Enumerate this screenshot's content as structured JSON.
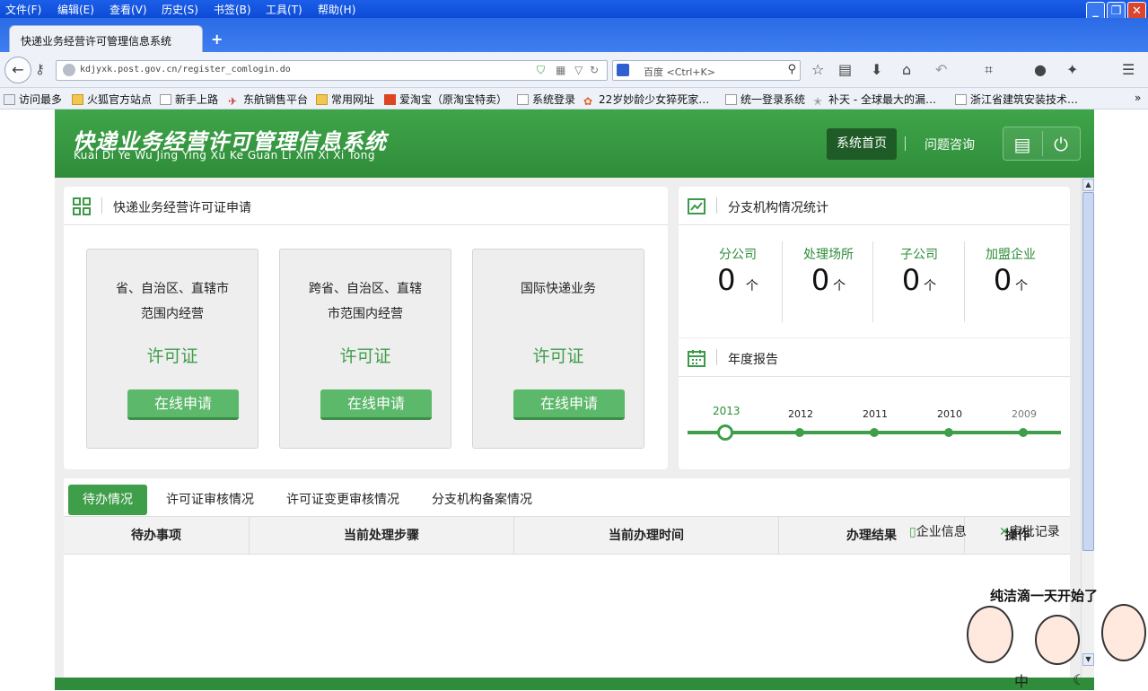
{
  "browser": {
    "menus": [
      "文件(F)",
      "编辑(E)",
      "查看(V)",
      "历史(S)",
      "书签(B)",
      "工具(T)",
      "帮助(H)"
    ],
    "tab_title": "快递业务经营许可管理信息系统",
    "new_tab": "+",
    "url": "kdjyxk.post.gov.cn/register_comlogin.do",
    "search_placeholder": "百度 <Ctrl+K>",
    "bookmarks": [
      "访问最多",
      "火狐官方站点",
      "新手上路",
      "东航销售平台",
      "常用网址",
      "爱淘宝（原淘宝特卖）",
      "系统登录",
      "22岁妙龄少女猝死家…",
      "统一登录系统",
      "补天 - 全球最大的漏…",
      "浙江省建筑安装技术…"
    ],
    "overflow": "»"
  },
  "header": {
    "title_cn": "快递业务经营许可管理信息系统",
    "title_en": "Kuai Di Ye Wu Jing Ying Xu Ke Guan Li Xin Xi Xi Tong",
    "nav_home": "系统首页",
    "nav_consult": "问题咨询"
  },
  "license_panel": {
    "title": "快递业务经营许可证申请",
    "cards": [
      {
        "line1": "省、自治区、直辖市",
        "line2": "范围内经营",
        "license": "许可证",
        "button": "在线申请"
      },
      {
        "line1": "跨省、自治区、直辖",
        "line2": "市范围内经营",
        "license": "许可证",
        "button": "在线申请"
      },
      {
        "line1": "国际快递业务",
        "line2": "",
        "license": "许可证",
        "button": "在线申请"
      }
    ]
  },
  "branch_stats": {
    "title": "分支机构情况统计",
    "items": [
      {
        "label": "分公司",
        "value": "0",
        "unit": "个"
      },
      {
        "label": "处理场所",
        "value": "0",
        "unit": "个"
      },
      {
        "label": "子公司",
        "value": "0",
        "unit": "个"
      },
      {
        "label": "加盟企业",
        "value": "0",
        "unit": "个"
      }
    ]
  },
  "annual_report": {
    "title": "年度报告",
    "years": [
      "2013",
      "2012",
      "2011",
      "2010",
      "2009"
    ],
    "selected": "2013"
  },
  "tabs": [
    "待办情况",
    "许可证审核情况",
    "许可证变更审核情况",
    "分支机构备案情况"
  ],
  "table": {
    "headers": [
      "待办事项",
      "当前处理步骤",
      "当前办理时间",
      "办理结果",
      "操作"
    ]
  },
  "overlay": {
    "company_info": "企业信息",
    "approval_record": "审批记录"
  },
  "mascot": {
    "caption": "纯洁滴一天开始了"
  },
  "colors": {
    "brand_green": "#3f9e4a",
    "header_green": "#2f8c3a",
    "nav_active": "#1e5b26"
  }
}
